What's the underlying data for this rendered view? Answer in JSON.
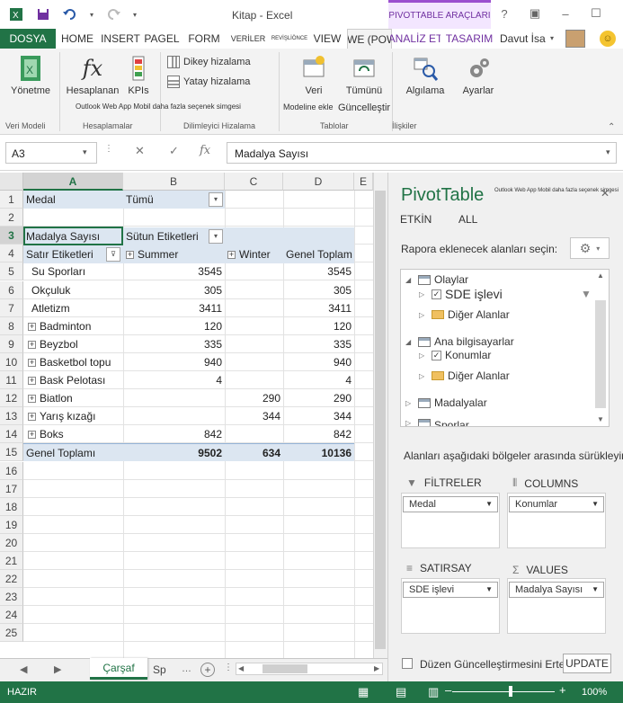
{
  "title_bar": {
    "doc_title": "Kitap - Excel",
    "context_title": "PIVOTTABLE ARAÇLARI",
    "qat_icons": [
      "excel-icon",
      "save-icon",
      "undo-icon",
      "redo-icon"
    ],
    "window_icons": [
      "help-icon",
      "restore-ribbon-icon",
      "minimize-icon",
      "maximize-icon",
      "close-icon"
    ]
  },
  "tabs": {
    "file": "DOSYA",
    "home": "HOME",
    "insert": "INSERT",
    "page": "PAGEL",
    "form": "FORM",
    "data": "VERİLER",
    "review": "REVİŞLİÖNCE",
    "view": "VIEW",
    "power": "POWE (POWE)",
    "analyze": "ANALİZ ET",
    "design": "TASARIM",
    "user": "Davut İsa"
  },
  "ribbon": {
    "manage": "Yönetme",
    "calculations": "Hesaplanan",
    "kpis": "KPIs",
    "vertical_align": "Dikey hizalama",
    "horizontal_align": "Yatay hizalama",
    "add_to_data_model": "Veri",
    "update_all": "Tümünü",
    "update_all_sub": "Güncelleştir",
    "add_to_model_sub": "Modeline ekle",
    "relationships": "Algılama",
    "settings": "Ayarlar",
    "tooltip": "Outlook Web App Mobil daha fazla seçenek simgesi",
    "groups": {
      "data_model": "Veri Modeli",
      "calculations": "Hesaplamalar",
      "slicer_align": "Dilimleyici Hizalama",
      "tables": "Tablolar",
      "relationships": "İlişkiler"
    }
  },
  "formula_bar": {
    "name_box": "A3",
    "formula": "Madalya Sayısı",
    "icons": [
      "cancel-icon",
      "enter-icon",
      "function-icon"
    ]
  },
  "grid": {
    "columns": [
      "A",
      "B",
      "C",
      "D",
      "E"
    ],
    "rows": [
      "1",
      "2",
      "3",
      "4",
      "5",
      "6",
      "7",
      "8",
      "9",
      "10",
      "11",
      "12",
      "13",
      "14",
      "15",
      "16",
      "17",
      "18",
      "19",
      "20",
      "21",
      "22",
      "23",
      "24",
      "25"
    ],
    "cells": {
      "a1": "Medal",
      "b1": "Tümü",
      "a3": "Madalya Sayısı",
      "b3": "Sütun Etiketleri",
      "a4": "Satır Etiketleri",
      "b4": "Summer",
      "c4": "Winter",
      "d4": "Genel Toplam"
    },
    "pivot_rows": [
      {
        "label": "Su Sporları",
        "expand": false,
        "summer": "3545",
        "winter": "",
        "total": "3545"
      },
      {
        "label": "Okçuluk",
        "expand": false,
        "summer": "305",
        "winter": "",
        "total": "305"
      },
      {
        "label": "Atletizm",
        "expand": false,
        "summer": "3411",
        "winter": "",
        "total": "3411"
      },
      {
        "label": "Badminton",
        "expand": true,
        "summer": "120",
        "winter": "",
        "total": "120"
      },
      {
        "label": "Beyzbol",
        "expand": true,
        "summer": "335",
        "winter": "",
        "total": "335"
      },
      {
        "label": "Basketbol topu",
        "expand": true,
        "summer": "940",
        "winter": "",
        "total": "940"
      },
      {
        "label": "Bask Pelotası",
        "expand": true,
        "summer": "4",
        "winter": "",
        "total": "4"
      },
      {
        "label": "Biatlon",
        "expand": true,
        "summer": "",
        "winter": "290",
        "total": "290"
      },
      {
        "label": "Yarış kızağı",
        "expand": true,
        "summer": "",
        "winter": "344",
        "total": "344"
      },
      {
        "label": "Boks",
        "expand": true,
        "summer": "842",
        "winter": "",
        "total": "842"
      }
    ],
    "grand_total": {
      "label": "Genel Toplamı",
      "summer": "9502",
      "winter": "634",
      "total": "10136"
    }
  },
  "sheets": {
    "active": "Çarşaf",
    "next": "Sp",
    "add": "+"
  },
  "pivot_pane": {
    "title": "PivotTable",
    "tooltip": "Outlook Web App Mobil daha fazla seçenek simgesi",
    "tab_active": "ETKİN",
    "tab_all": "ALL",
    "prompt": "Rapora eklenecek alanları seçin:",
    "fields": {
      "olaylar": "Olaylar",
      "sde": "SDE işlevi",
      "diger1": "Diğer Alanlar",
      "ana": "Ana bilgisayarlar",
      "konumlar": "Konumlar",
      "diger2": "Diğer Alanlar",
      "madalyalar": "Madalyalar",
      "sporlar": "Sporlar"
    },
    "areas_prompt": "Alanları aşağıdaki bölgeler arasında sürükleyin:",
    "filters": {
      "label": "FİLTRELER",
      "chip": "Medal"
    },
    "columns": {
      "label": "COLUMNS",
      "chip": "Konumlar"
    },
    "rows": {
      "label": "SATIRSAY",
      "chip": "SDE işlevi"
    },
    "values": {
      "label": "VALUES",
      "chip": "Madalya Sayısı"
    },
    "defer_label": "Düzen Güncelleştirmesini Ertele",
    "update": "UPDATE"
  },
  "status_bar": {
    "status": "HAZIR",
    "zoom": "100%",
    "zoom_level": 1.0
  },
  "colors": {
    "accent": "#217346",
    "context": "#7030a0",
    "pivot_header": "#dce6f1"
  }
}
